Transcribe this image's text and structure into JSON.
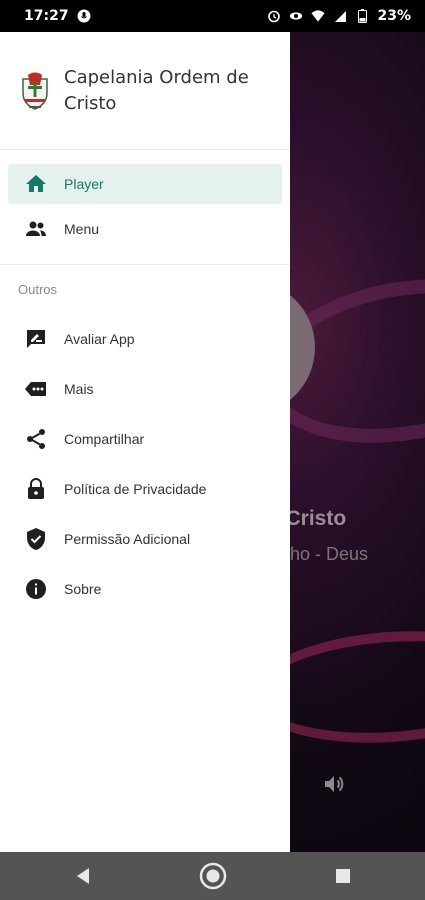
{
  "status_bar": {
    "time": "17:27",
    "battery": "23%"
  },
  "drawer": {
    "app_title": "Capelania Ordem de Cristo",
    "main_items": [
      {
        "label": "Player",
        "icon": "home-icon",
        "active": true
      },
      {
        "label": "Menu",
        "icon": "people-icon",
        "active": false
      }
    ],
    "section_label": "Outros",
    "other_items": [
      {
        "label": "Avaliar App",
        "icon": "rate-review-icon"
      },
      {
        "label": "Mais",
        "icon": "more-label-icon"
      },
      {
        "label": "Compartilhar",
        "icon": "share-icon"
      },
      {
        "label": "Política de Privacidade",
        "icon": "lock-icon"
      },
      {
        "label": "Permissão Adicional",
        "icon": "shield-check-icon"
      },
      {
        "label": "Sobre",
        "icon": "info-icon"
      }
    ]
  },
  "player_background": {
    "station_partial": "e Cristo",
    "song_partial": "olho - Deus"
  },
  "colors": {
    "accent": "#127a68",
    "active_bg": "#e4f1ee",
    "icon": "#1f1f1f"
  }
}
